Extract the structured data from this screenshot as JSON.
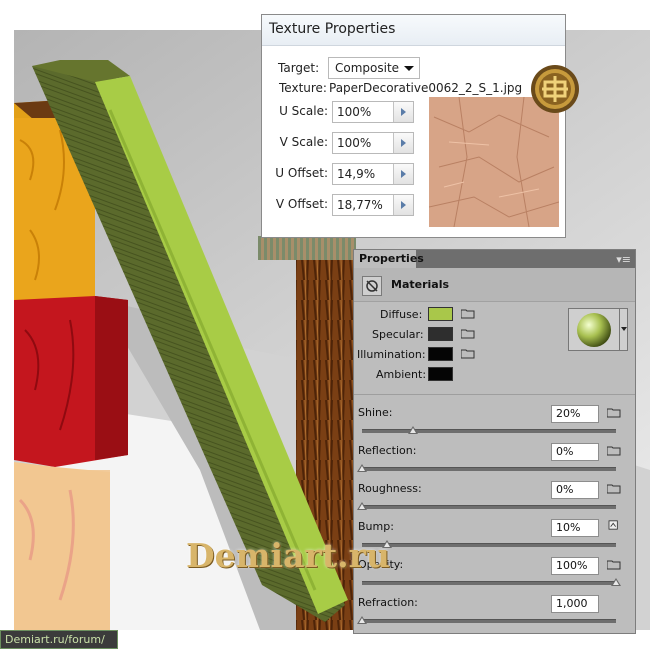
{
  "texture_properties": {
    "title": "Texture Properties",
    "target_label": "Target:",
    "target_value": "Composite",
    "texture_label": "Texture:",
    "texture_value": "PaperDecorative0062_2_S_1.jpg",
    "fields": [
      {
        "label": "U Scale:",
        "value": "100%"
      },
      {
        "label": "V Scale:",
        "value": "100%"
      },
      {
        "label": "U Offset:",
        "value": "14,9%"
      },
      {
        "label": "V Offset:",
        "value": "18,77%"
      }
    ]
  },
  "properties_panel": {
    "tab": "Properties",
    "section": "Materials",
    "swatches": [
      {
        "label": "Diffuse:",
        "color": "#a9c74a"
      },
      {
        "label": "Specular:",
        "color": "#2e2e2e"
      },
      {
        "label": "Illumination:",
        "color": "#050505"
      },
      {
        "label": "Ambient:",
        "color": "#050505"
      }
    ],
    "sliders": [
      {
        "label": "Shine:",
        "value": "20%",
        "fraction": 0.2
      },
      {
        "label": "Reflection:",
        "value": "0%",
        "fraction": 0.0
      },
      {
        "label": "Roughness:",
        "value": "0%",
        "fraction": 0.0
      },
      {
        "label": "Bump:",
        "value": "10%",
        "fraction": 0.1
      },
      {
        "label": "Opacity:",
        "value": "100%",
        "fraction": 1.0
      },
      {
        "label": "Refraction:",
        "value": "1,000",
        "fraction": 0.0
      }
    ]
  },
  "watermark": "Demiart.ru",
  "footer_link": "Demiart.ru/forum/"
}
